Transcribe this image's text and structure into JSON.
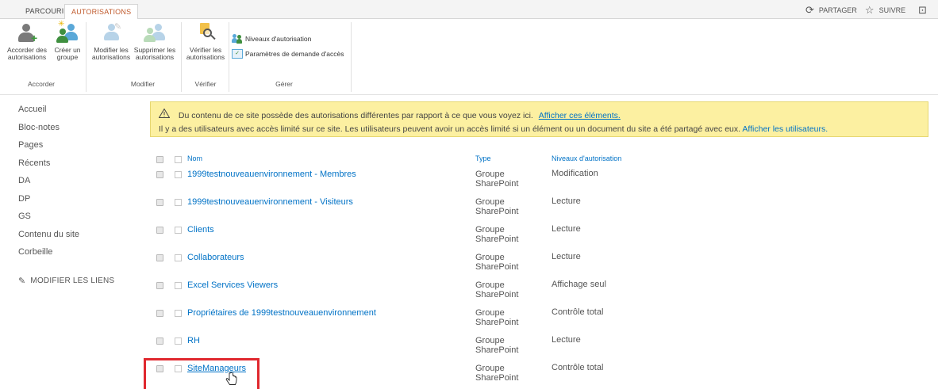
{
  "ribbon_tabs": [
    "PARCOURIR",
    "AUTORISATIONS"
  ],
  "top_actions": {
    "share": "PARTAGER",
    "follow": "SUIVRE"
  },
  "ribbon": {
    "groups": [
      {
        "label": "Accorder",
        "buttons": [
          "Accorder des autorisations",
          "Créer un groupe"
        ]
      },
      {
        "label": "Modifier",
        "buttons": [
          "Modifier les autorisations",
          "Supprimer les autorisations"
        ]
      },
      {
        "label": "Vérifier",
        "buttons": [
          "Vérifier les autorisations"
        ]
      },
      {
        "label": "Gérer",
        "commands": [
          "Niveaux d'autorisation",
          "Paramètres de demande d'accès"
        ]
      }
    ],
    "btn_labels": {
      "grant_l1": "Accorder des",
      "grant_l2": "autorisations",
      "create_l1": "Créer un",
      "create_l2": "groupe",
      "edit_l1": "Modifier les",
      "edit_l2": "autorisations",
      "delete_l1": "Supprimer les",
      "delete_l2": "autorisations",
      "check_l1": "Vérifier les",
      "check_l2": "autorisations"
    }
  },
  "nav": {
    "items": [
      "Accueil",
      "Bloc-notes",
      "Pages",
      "Récents",
      "DA",
      "DP",
      "GS",
      "Contenu du site",
      "Corbeille"
    ],
    "edit_links": "MODIFIER LES LIENS"
  },
  "warning": {
    "line1": "Du contenu de ce site possède des autorisations différentes par rapport à ce que vous voyez ici.",
    "line1_link": "Afficher ces éléments.",
    "line2": "Il y a des utilisateurs avec accès limité sur ce site. Les utilisateurs peuvent avoir un accès limité si un élément ou un document du site a été partagé avec eux.",
    "line2_link": "Afficher les utilisateurs."
  },
  "table": {
    "columns": {
      "name": "Nom",
      "type": "Type",
      "level": "Niveaux d'autorisation"
    },
    "type_l1": "Groupe",
    "type_l2": "SharePoint",
    "rows": [
      {
        "name": "1999testnouveauenvironnement - Membres",
        "level": "Modification"
      },
      {
        "name": "1999testnouveauenvironnement - Visiteurs",
        "level": "Lecture"
      },
      {
        "name": "Clients",
        "level": "Lecture"
      },
      {
        "name": "Collaborateurs",
        "level": "Lecture"
      },
      {
        "name": "Excel Services Viewers",
        "level": "Affichage seul"
      },
      {
        "name": "Propriétaires de 1999testnouveauenvironnement",
        "level": "Contrôle total"
      },
      {
        "name": "RH",
        "level": "Lecture"
      },
      {
        "name": "SiteManageurs",
        "level": "Contrôle total"
      }
    ]
  },
  "colors": {
    "accent": "#c0592b",
    "link": "#0072c6",
    "warning_bg": "#fcf0a1",
    "highlight": "#e0282e"
  }
}
